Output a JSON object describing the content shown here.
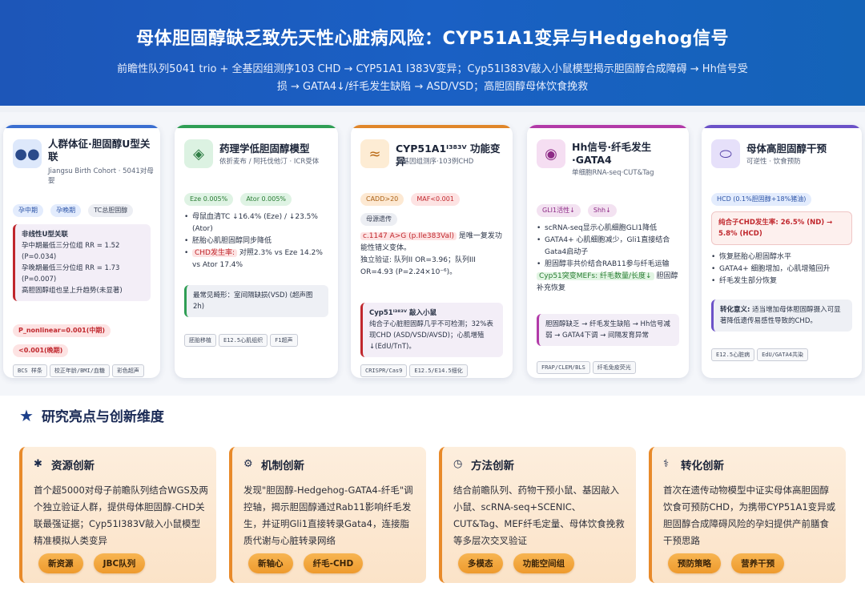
{
  "header": {
    "title": "母体胆固醇缺乏致先天性心脏病风险：CYP51A1变异与Hedgehog信号",
    "subtitle": "前瞻性队列5041 trio + 全基因组测序103 CHD → CYP51A1 I383V变异；Cyp51I383V敲入小鼠模型揭示胆固醇合成障碍 → Hh信号受损 → GATA4↓/纤毛发生缺陷 → ASD/VSD；高胆固醇母体饮食挽救"
  },
  "cards": [
    {
      "title": "人群体征·胆固醇U型关联",
      "sub": "Jiangsu Birth Cohort · 5041对母婴",
      "icon": "people-icon",
      "accent": "#3b6fd1",
      "pills": [
        "孕中期",
        "孕晚期",
        "TC总胆固醇"
      ],
      "note_title": "非线性U型关联",
      "note_lines": [
        "孕中期最低三分位组 RR = 1.52 (P=0.034)",
        "孕晚期最低三分位组 RR = 1.73 (P=0.007)",
        "高胆固醇组也呈上升趋势(未显著)"
      ],
      "red_pills": [
        "P_nonlinear=0.001(中期)",
        "<0.001(晚期)"
      ],
      "tags": [
        "BCS 样条",
        "校正年龄/BMI/血糖",
        "彩色超声"
      ]
    },
    {
      "title": "药理学低胆固醇模型",
      "sub": "依折麦布 / 阿托伐他汀 · ICR受体",
      "icon": "mouse-icon",
      "accent": "#2f9e55",
      "pills": [
        "Eze 0.005%",
        "Ator 0.005%"
      ],
      "bullets": [
        "母鼠血清TC ↓16.4% (Eze) / ↓23.5% (Ator)",
        "胚胎心肌胆固醇同步降低"
      ],
      "chd_label": "CHD发生率:",
      "chd_text": "对照2.3% vs Eze 14.2% vs Ator 17.4%",
      "note": "最常见畸形：室间隔缺损(VSD) (超声图2h)",
      "tags": [
        "胚胎移植",
        "E12.5心肌组织",
        "F1超声"
      ]
    },
    {
      "title": "CYP51A1ᴵ³⁸³ⱽ 功能变异",
      "sub": "全基因组测序·103例CHD",
      "icon": "dna-icon",
      "accent": "#e0862a",
      "pills": [
        "CADD>20",
        "MAF<0.001"
      ],
      "pill_second": "母源遗传",
      "variant": "c.1147 A>G (p.Ile383Val)",
      "variant_text": "是唯一复发功能性错义变体。",
      "validation": "独立验证: 队列II OR=3.96；队列III OR=4.93 (P=2.24×10⁻⁶)。",
      "note_title": "Cyp51ᴵ³⁸³ⱽ 敲入小鼠",
      "note": "纯合子心脏胆固醇几乎不可检测；32%表现CHD (ASD/VSD/AVSD)；心肌增殖↓(EdU/TnT)。",
      "tags": [
        "CRISPR/Cas9",
        "E12.5/E14.5细化"
      ]
    },
    {
      "title": "Hh信号·纤毛发生·GATA4",
      "sub": "单细胞RNA-seq·CUT&Tag",
      "icon": "signal-icon",
      "accent": "#b23aa8",
      "pills": [
        "GLI1活性↓",
        "Shh↓"
      ],
      "bullets": [
        "scRNA-seq显示心肌细胞GLI1降低",
        "GATA4+ 心肌细胞减少，Gli1直接结合Gata4启动子",
        "胆固醇非共价结合RAB11参与纤毛运输"
      ],
      "mef": "Cyp51突变MEFs: 纤毛数量/长度↓",
      "mef_text": "胆固醇补充恢复",
      "note": "胆固醇缺乏 → 纤毛发生缺陷 → Hh信号减弱 → GATA4下调 → 间隔发育异常",
      "tags": [
        "FRAP/CLEM/BLS",
        "纤毛免疫荧光"
      ]
    },
    {
      "title": "母体高胆固醇干预",
      "sub": "可逆性 · 饮食预防",
      "icon": "egg-icon",
      "accent": "#6b52c8",
      "pills": [
        "HCD (0.1%胆固醇+18%猪油)"
      ],
      "rate": "纯合子CHD发生率: 26.5% (ND) → 5.8% (HCD)",
      "bullets": [
        "恢复胚胎心胆固醇水平",
        "GATA4+ 细胞增加，心肌增殖回升",
        "纤毛发生部分恢复"
      ],
      "note_title": "转化意义:",
      "note": "适当增加母体胆固醇摄入可显著降低遗传易感性导致的CHD。",
      "tags": [
        "E12.5心脏病",
        "EdU/GATA4共染"
      ]
    }
  ],
  "highlights": {
    "section_title": "研究亮点与创新维度",
    "items": [
      {
        "icon": "bulb-icon",
        "title": "资源创新",
        "body": "首个超5000对母子前瞻队列结合WGS及两个独立验证人群，提供母体胆固醇-CHD关联最强证据；Cyp51I383V敲入小鼠模型精准模拟人类变异",
        "buttons": [
          "新资源",
          "JBC队列"
        ]
      },
      {
        "icon": "gears-icon",
        "title": "机制创新",
        "body": "发现\"胆固醇-Hedgehog-GATA4-纤毛\"调控轴，揭示胆固醇通过Rab11影响纤毛发生，并证明Gli1直接转录Gata4，连接脂质代谢与心脏转录网络",
        "buttons": [
          "新轴心",
          "纤毛-CHD"
        ]
      },
      {
        "icon": "clock-icon",
        "title": "方法创新",
        "body": "结合前瞻队列、药物干预小鼠、基因敲入小鼠、scRNA-seq+SCENIC、CUT&Tag、MEF纤毛定量、母体饮食挽救等多层次交叉验证",
        "buttons": [
          "多模态",
          "功能空间组"
        ]
      },
      {
        "icon": "stethoscope-icon",
        "title": "转化创新",
        "body": "首次在遗传动物模型中证实母体高胆固醇饮食可预防CHD，为携带CYP51A1变异或胆固醇合成障碍风险的孕妇提供产前膳食干预思路",
        "buttons": [
          "预防策略",
          "营养干预"
        ]
      }
    ]
  }
}
